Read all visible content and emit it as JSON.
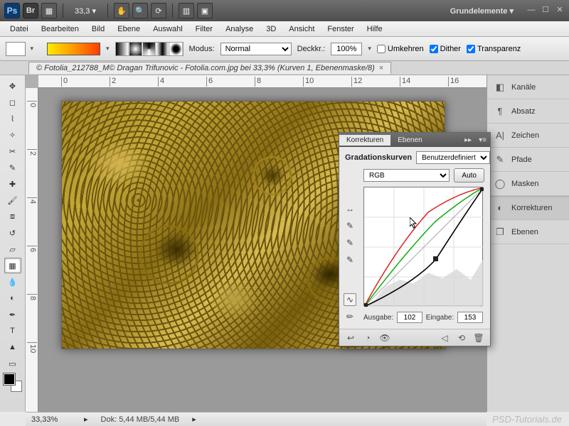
{
  "app_bar": {
    "ps": "Ps",
    "br": "Br",
    "zoom": "33,3 ▾",
    "essentials": "Grundelemente ▾"
  },
  "menu": [
    "Datei",
    "Bearbeiten",
    "Bild",
    "Ebene",
    "Auswahl",
    "Filter",
    "Analyse",
    "3D",
    "Ansicht",
    "Fenster",
    "Hilfe"
  ],
  "options": {
    "mode_label": "Modus:",
    "mode_value": "Normal",
    "opacity_label": "Deckkr.:",
    "opacity_value": "100%",
    "reverse": "Umkehren",
    "dither": "Dither",
    "transparency": "Transparenz"
  },
  "document": {
    "tab_title": "© Fotolia_212788_M© Dragan Trifunovic - Fotolia.com.jpg bei 33,3% (Kurven 1, Ebenenmaske/8)",
    "close": "×"
  },
  "ruler_marks_h": [
    "0",
    "2",
    "4",
    "6",
    "8",
    "10",
    "12",
    "14",
    "16"
  ],
  "ruler_marks_v": [
    "0",
    "2",
    "4",
    "6",
    "8",
    "10"
  ],
  "right_panels": [
    {
      "icon": "◧",
      "label": "Kanäle"
    },
    {
      "icon": "¶",
      "label": "Absatz"
    },
    {
      "icon": "A|",
      "label": "Zeichen"
    },
    {
      "icon": "✎",
      "label": "Pfade"
    },
    {
      "icon": "◯",
      "label": "Masken"
    },
    {
      "icon": "◐",
      "label": "Korrekturen"
    },
    {
      "icon": "❐",
      "label": "Ebenen"
    }
  ],
  "status": {
    "zoom": "33,33%",
    "doc": "Dok: 5,44 MB/5,44 MB"
  },
  "curves": {
    "tab_adjust": "Korrekturen",
    "tab_layers": "Ebenen",
    "title": "Gradationskurven",
    "preset": "Benutzerdefiniert",
    "channel": "RGB",
    "auto": "Auto",
    "output_label": "Ausgabe:",
    "output_value": "102",
    "input_label": "Eingabe:",
    "input_value": "153"
  },
  "watermark": "PSD-Tutorials.de",
  "chart_data": {
    "type": "line",
    "title": "Gradationskurven",
    "xlabel": "Eingabe",
    "ylabel": "Ausgabe",
    "xlim": [
      0,
      255
    ],
    "ylim": [
      0,
      255
    ],
    "series": [
      {
        "name": "baseline",
        "color": "#999",
        "values": [
          [
            0,
            0
          ],
          [
            255,
            255
          ]
        ]
      },
      {
        "name": "RGB",
        "color": "#000",
        "values": [
          [
            0,
            0
          ],
          [
            153,
            102
          ],
          [
            255,
            255
          ]
        ]
      },
      {
        "name": "R",
        "color": "#d22",
        "values": [
          [
            0,
            0
          ],
          [
            60,
            120
          ],
          [
            128,
            200
          ],
          [
            200,
            245
          ],
          [
            255,
            255
          ]
        ]
      },
      {
        "name": "G",
        "color": "#1a1",
        "values": [
          [
            0,
            0
          ],
          [
            70,
            110
          ],
          [
            140,
            185
          ],
          [
            210,
            235
          ],
          [
            255,
            255
          ]
        ]
      }
    ],
    "selected_point": {
      "input": 153,
      "output": 102
    },
    "histogram": true
  }
}
